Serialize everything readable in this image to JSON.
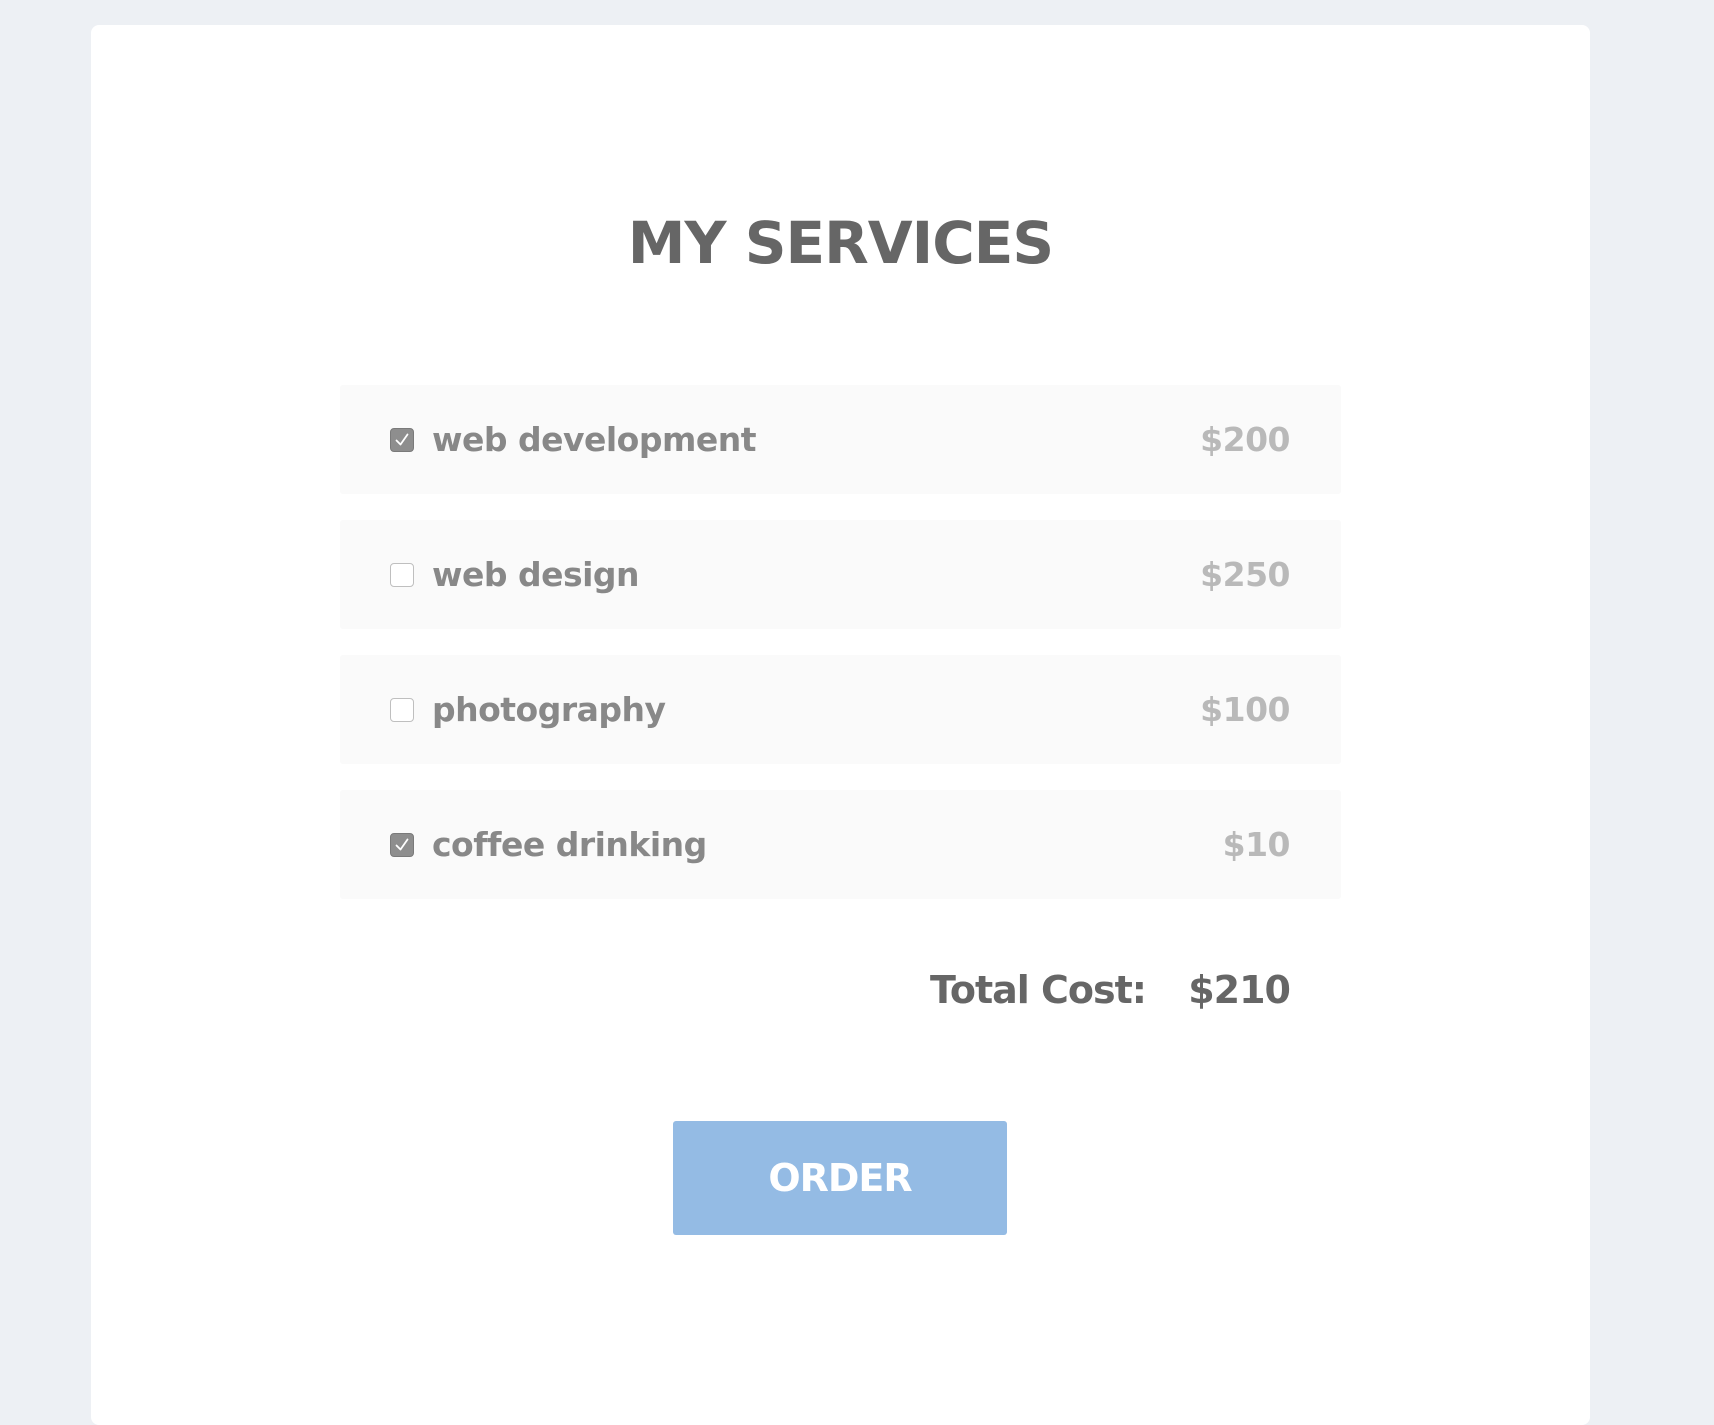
{
  "page": {
    "title": "MY SERVICES"
  },
  "services": [
    {
      "label": "web development",
      "price": "$200",
      "checked": true
    },
    {
      "label": "web design",
      "price": "$250",
      "checked": false
    },
    {
      "label": "photography",
      "price": "$100",
      "checked": false
    },
    {
      "label": "coffee drinking",
      "price": "$10",
      "checked": true
    }
  ],
  "total": {
    "label": "Total Cost:",
    "value": "$210"
  },
  "order_button": {
    "label": "ORDER"
  },
  "colors": {
    "background": "#edf0f4",
    "card": "#ffffff",
    "row": "#fafafa",
    "heading_text": "#666666",
    "label_text": "#888888",
    "price_text": "#b9b9b9",
    "checkbox_checked": "#8e8e8e",
    "button": "#94bbe4",
    "button_text": "#ffffff"
  },
  "icons": {
    "checkmark": "check-icon"
  }
}
